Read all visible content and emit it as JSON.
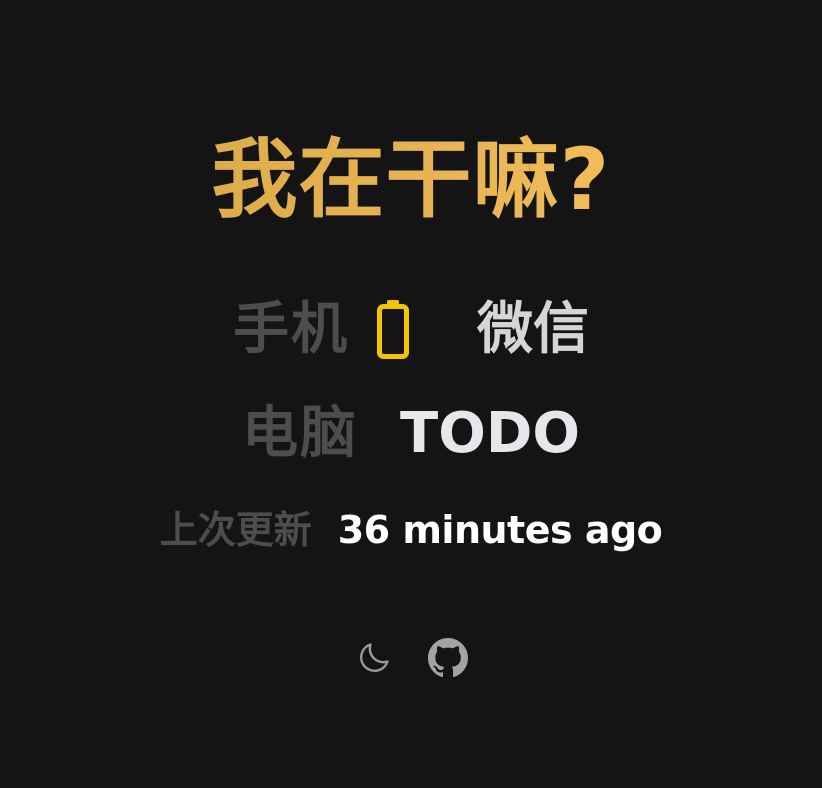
{
  "title": "我在干嘛?",
  "phone": {
    "label": "手机",
    "battery_icon": "battery-icon",
    "battery_color": "#f5c400",
    "app": "微信"
  },
  "pc": {
    "label": "电脑",
    "app": "TODO"
  },
  "update": {
    "label": "上次更新",
    "time": "36 minutes ago"
  },
  "footer": {
    "icons": [
      "moon-icon",
      "github-icon"
    ]
  },
  "colors": {
    "background": "#141414",
    "title": "#e9b554",
    "label": "#4d4d4d",
    "value": "#e5e7eb"
  }
}
